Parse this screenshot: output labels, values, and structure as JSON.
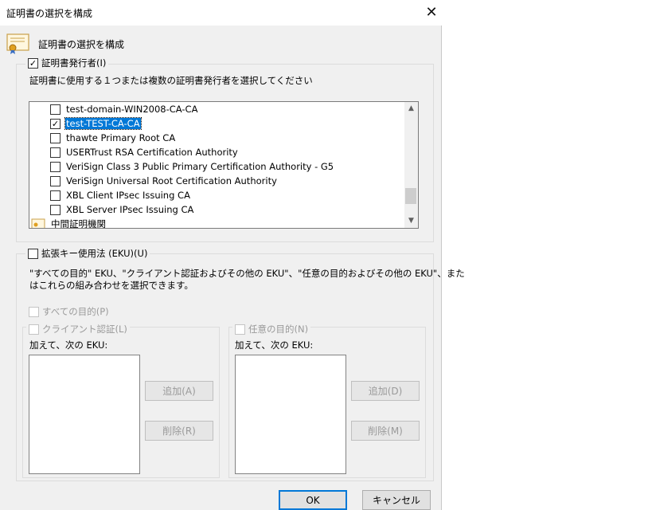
{
  "window": {
    "title": "証明書の選択を構成",
    "close_glyph": "✕"
  },
  "header": {
    "label": "証明書の選択を構成"
  },
  "issuer_group": {
    "legend": "証明書発行者(I)",
    "checked": true,
    "description": "証明書に使用する１つまたは複数の証明書発行者を選択してください",
    "items": [
      {
        "label": "test-domain-WIN2008-CA-CA",
        "checked": false,
        "selected": false
      },
      {
        "label": "test-TEST-CA-CA",
        "checked": true,
        "selected": true
      },
      {
        "label": "thawte Primary Root CA",
        "checked": false,
        "selected": false
      },
      {
        "label": "USERTrust RSA Certification Authority",
        "checked": false,
        "selected": false
      },
      {
        "label": "VeriSign Class 3 Public Primary Certification Authority - G5",
        "checked": false,
        "selected": false
      },
      {
        "label": "VeriSign Universal Root Certification Authority",
        "checked": false,
        "selected": false
      },
      {
        "label": "XBL Client IPsec Issuing CA",
        "checked": false,
        "selected": false
      },
      {
        "label": "XBL Server IPsec Issuing CA",
        "checked": false,
        "selected": false
      }
    ],
    "partial_node": {
      "label": "中間証明機関",
      "icon": "folder-cert-icon"
    }
  },
  "eku_group": {
    "legend": "拡張キー使用法 (EKU)(U)",
    "checked": false,
    "description_line1": "\"すべての目的\" EKU、\"クライアント認証およびその他の EKU\"、\"任意の目的およびその他の EKU\"、また",
    "description_line2": "はこれらの組み合わせを選択できます。",
    "all_purposes": "すべての目的(P)",
    "client_auth": {
      "legend": "クライアント認証(L)",
      "also_label": "加えて、次の EKU:",
      "add_button": "追加(A)",
      "remove_button": "削除(R)"
    },
    "any_purpose": {
      "legend": "任意の目的(N)",
      "also_label": "加えて、次の EKU:",
      "add_button": "追加(D)",
      "remove_button": "削除(M)"
    }
  },
  "footer": {
    "ok": "OK",
    "cancel": "キャンセル"
  },
  "colors": {
    "selection": "#0078d7",
    "dialog_bg": "#f0f0f0"
  }
}
